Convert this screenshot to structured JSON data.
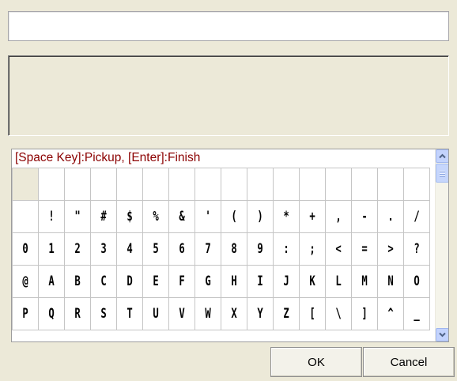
{
  "input": {
    "value": ""
  },
  "hint": "[Space Key]:Pickup, [Enter]:Finish",
  "grid": {
    "rows": [
      [
        "",
        "",
        "",
        "",
        "",
        "",
        "",
        "",
        "",
        "",
        "",
        "",
        "",
        "",
        "",
        ""
      ],
      [
        "",
        "!",
        "\"",
        "#",
        "$",
        "%",
        "&",
        "'",
        "(",
        ")",
        "*",
        "+",
        ",",
        "-",
        ".",
        "/"
      ],
      [
        "0",
        "1",
        "2",
        "3",
        "4",
        "5",
        "6",
        "7",
        "8",
        "9",
        ":",
        ";",
        "<",
        "=",
        ">",
        "?"
      ],
      [
        "@",
        "A",
        "B",
        "C",
        "D",
        "E",
        "F",
        "G",
        "H",
        "I",
        "J",
        "K",
        "L",
        "M",
        "N",
        "O"
      ],
      [
        "P",
        "Q",
        "R",
        "S",
        "T",
        "U",
        "V",
        "W",
        "X",
        "Y",
        "Z",
        "[",
        "\\",
        "]",
        "^",
        "_"
      ]
    ],
    "selected_index": 0
  },
  "buttons": {
    "ok": "OK",
    "cancel": "Cancel"
  },
  "icons": {
    "scroll_up": "chevron-up-icon",
    "scroll_down": "chevron-down-icon"
  },
  "colors": {
    "hint": "#8b0000",
    "selected_cell": "#ece9d8",
    "scrollbar_button": "#c3d3fd"
  }
}
